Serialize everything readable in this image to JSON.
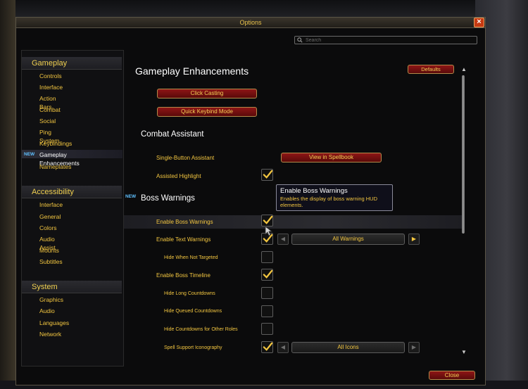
{
  "window": {
    "title": "Options"
  },
  "search": {
    "placeholder": "Search"
  },
  "sidebar": {
    "categories": [
      {
        "label": "Gameplay",
        "items": [
          "Controls",
          "Interface",
          "Action Bars",
          "Combat",
          "Social",
          "Ping System",
          "Keybindings",
          "Gameplay Enhancements",
          "Nameplates"
        ]
      },
      {
        "label": "Accessibility",
        "items": [
          "Interface",
          "General",
          "Colors",
          "Audio Assist",
          "Mounts",
          "Subtitles"
        ]
      },
      {
        "label": "System",
        "items": [
          "Graphics",
          "Audio",
          "Languages",
          "Network"
        ]
      }
    ],
    "active_item": "Gameplay Enhancements",
    "new_badge": "NEW"
  },
  "panel": {
    "title": "Gameplay Enhancements",
    "defaults_label": "Defaults",
    "click_casting_label": "Click Casting",
    "quick_keybind_label": "Quick Keybind Mode",
    "combat_assistant": {
      "title": "Combat Assistant",
      "single_button_label": "Single-Button Assistant",
      "view_spellbook_label": "View in Spellbook",
      "assisted_highlight_label": "Assisted Highlight",
      "assisted_highlight_checked": true
    },
    "boss_warnings": {
      "new_badge": "NEW",
      "title": "Boss Warnings",
      "rows": [
        {
          "label": "Enable Boss Warnings",
          "checked": true
        },
        {
          "label": "Enable Text Warnings",
          "checked": true,
          "dropdown": "All Warnings"
        },
        {
          "label": "Hide When Not Targeted",
          "checked": false
        },
        {
          "label": "Enable Boss Timeline",
          "checked": true
        },
        {
          "label": "Hide Long Countdowns",
          "checked": false
        },
        {
          "label": "Hide Queued Countdowns",
          "checked": false
        },
        {
          "label": "Hide Countdowns for Other Roles",
          "checked": false
        },
        {
          "label": "Spell Support Iconography",
          "checked": true,
          "dropdown": "All Icons"
        }
      ]
    }
  },
  "tooltip": {
    "title": "Enable Boss Warnings",
    "body": "Enables the display of boss warning HUD elements."
  },
  "footer": {
    "close_label": "Close"
  },
  "colors": {
    "accent_gold": "#f3c640",
    "button_red": "#8e1616",
    "new_blue": "#5fc0ff"
  }
}
